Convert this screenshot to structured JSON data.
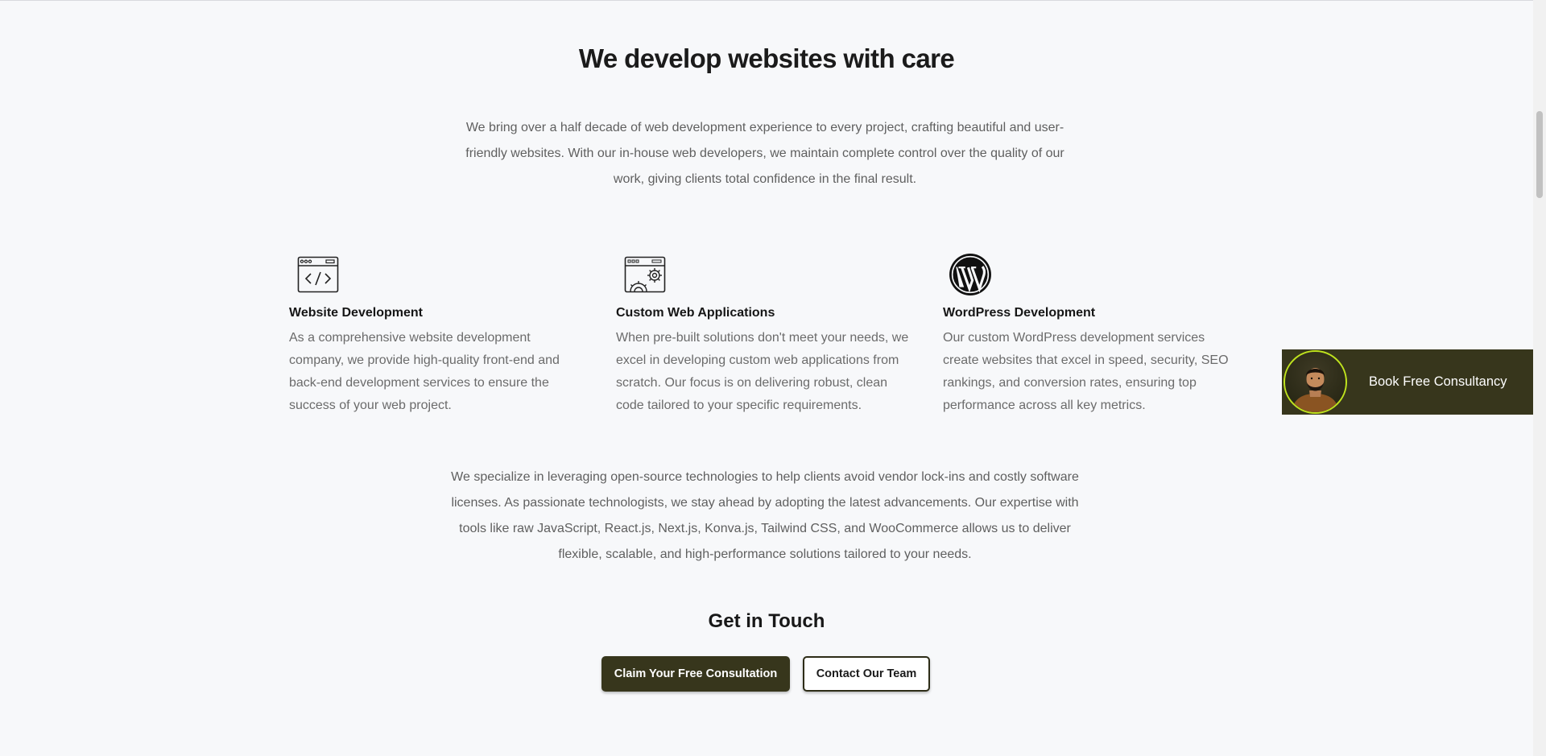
{
  "heading": "We develop websites with care",
  "intro": "We bring over a half decade of web development experience to every project, crafting beautiful and user-friendly websites. With our in-house web developers, we maintain complete control over the quality of our work, giving clients total confidence in the final result.",
  "services": [
    {
      "icon": "code-window-icon",
      "title": "Website Development",
      "text": "As a comprehensive website development company, we provide high-quality front-end and back-end development services to ensure the success of your web project."
    },
    {
      "icon": "web-app-gears-icon",
      "title": "Custom Web Applications",
      "text": "When pre-built solutions don't meet your needs, we excel in developing custom web applications from scratch. Our focus is on delivering robust, clean code tailored to your specific requirements."
    },
    {
      "icon": "wordpress-icon",
      "title": "WordPress Development",
      "text": "Our custom WordPress development services create websites that excel in speed, security, SEO rankings, and conversion rates, ensuring top performance across all key metrics."
    }
  ],
  "outro": "We specialize in leveraging open-source technologies to help clients avoid vendor lock-ins and costly software licenses. As passionate technologists, we stay ahead by adopting the latest advancements. Our expertise with tools like raw JavaScript, React.js, Next.js, Konva.js, Tailwind CSS, and WooCommerce allows us to deliver flexible, scalable, and high-performance solutions tailored to your needs.",
  "get_in_touch": "Get in Touch",
  "buttons": {
    "primary": "Claim Your Free Consultation",
    "secondary": "Contact Our Team"
  },
  "consult_widget": {
    "label": "Book Free Consultancy"
  },
  "colors": {
    "brand_dark": "#37361c",
    "accent_lime": "#bfe31e",
    "background": "#f7f8fa"
  }
}
